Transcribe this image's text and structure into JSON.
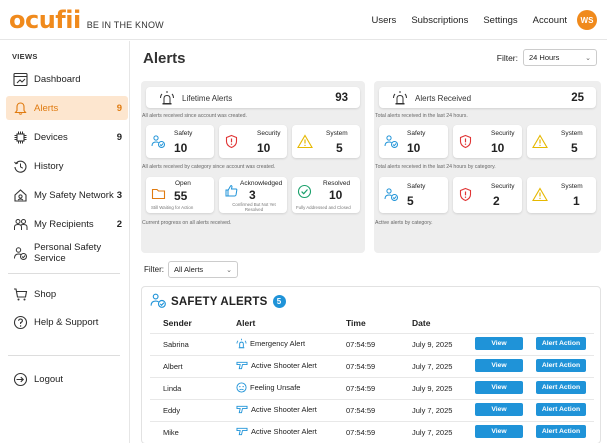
{
  "header": {
    "logo": "ocufii",
    "tagline": "BE IN THE KNOW",
    "nav": [
      "Users",
      "Subscriptions",
      "Settings",
      "Account"
    ],
    "avatar_initials": "WS",
    "accent_color": "#f08a1c"
  },
  "sidebar": {
    "section_label": "VIEWS",
    "items": [
      {
        "label": "Dashboard",
        "icon": "dashboard-icon",
        "count": ""
      },
      {
        "label": "Alerts",
        "icon": "bell-icon",
        "count": "9",
        "active": true
      },
      {
        "label": "Devices",
        "icon": "chip-icon",
        "count": "9"
      },
      {
        "label": "History",
        "icon": "history-icon",
        "count": ""
      },
      {
        "label": "My Safety Network",
        "icon": "house-network-icon",
        "count": "3"
      },
      {
        "label": "My Recipients",
        "icon": "people-icon",
        "count": "2"
      },
      {
        "label": "Personal Safety Service",
        "icon": "person-check-icon",
        "count": ""
      }
    ],
    "secondary": [
      {
        "label": "Shop",
        "icon": "cart-icon"
      },
      {
        "label": "Help & Support",
        "icon": "help-icon"
      }
    ],
    "logout": {
      "label": "Logout",
      "icon": "logout-icon"
    }
  },
  "main": {
    "title": "Alerts",
    "filter_label": "Filter:",
    "filter_value": "24 Hours",
    "lifetime": {
      "label": "Lifetime Alerts",
      "value": "93",
      "caption": "All alerts received since account was created.",
      "categories": [
        {
          "label": "Safety",
          "value": "10"
        },
        {
          "label": "Security",
          "value": "10"
        },
        {
          "label": "System",
          "value": "5"
        }
      ],
      "categories_caption": "All alerts received by category since account was created.",
      "progress": [
        {
          "label": "Open",
          "value": "55",
          "sub": "Still Waiting for Action"
        },
        {
          "label": "Acknowledged",
          "value": "3",
          "sub": "Confirmed But Not Yet Resolved"
        },
        {
          "label": "Resolved",
          "value": "10",
          "sub": "Fully Addressed and Closed"
        }
      ],
      "progress_caption": "Current progress on all alerts received."
    },
    "received": {
      "label": "Alerts Received",
      "value": "25",
      "caption": "Total alerts received in the last 24 hours.",
      "categories": [
        {
          "label": "Safety",
          "value": "10"
        },
        {
          "label": "Security",
          "value": "10"
        },
        {
          "label": "System",
          "value": "5"
        }
      ],
      "categories_caption": "Total alerts received in the last 24 hours by category.",
      "active": [
        {
          "label": "Safety",
          "value": "5"
        },
        {
          "label": "Security",
          "value": "2"
        },
        {
          "label": "System",
          "value": "1"
        }
      ],
      "active_caption": "Active alerts by category."
    },
    "list_filter_label": "Filter:",
    "list_filter_value": "All Alerts",
    "safety_alerts": {
      "title": "SAFETY ALERTS",
      "count": "5",
      "columns": [
        "Sender",
        "Alert",
        "Time",
        "Date"
      ],
      "view_label": "View",
      "action_label": "Alert Action",
      "rows": [
        {
          "sender": "Sabrina",
          "alert": "Emergency Alert",
          "icon": "emergency-icon",
          "time": "07:54:59",
          "date": "July 9, 2025"
        },
        {
          "sender": "Albert",
          "alert": "Active Shooter Alert",
          "icon": "gun-icon",
          "time": "07:54:59",
          "date": "July 7, 2025"
        },
        {
          "sender": "Linda",
          "alert": "Feeling Unsafe",
          "icon": "unsafe-face-icon",
          "time": "07:54:59",
          "date": "July 9, 2025"
        },
        {
          "sender": "Eddy",
          "alert": "Active Shooter Alert",
          "icon": "gun-icon",
          "time": "07:54:59",
          "date": "July 7, 2025"
        },
        {
          "sender": "Mike",
          "alert": "Active Shooter Alert",
          "icon": "gun-icon",
          "time": "07:54:59",
          "date": "July 7, 2025"
        }
      ]
    }
  }
}
